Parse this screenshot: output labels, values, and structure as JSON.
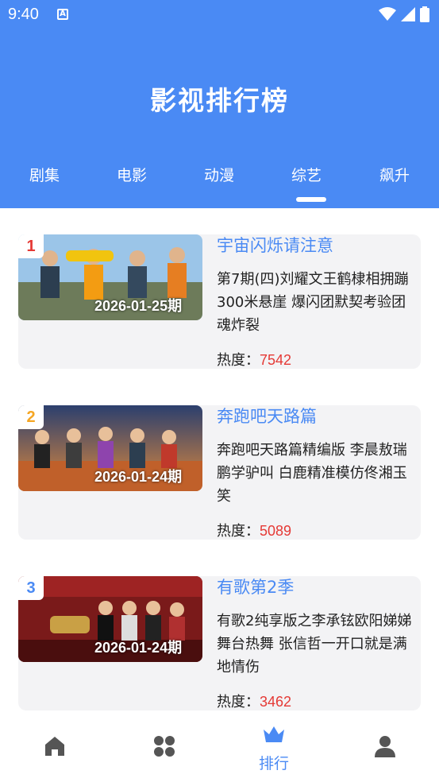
{
  "status": {
    "time": "9:40",
    "app_icon_letter": "A"
  },
  "app_title": "影视排行榜",
  "tabs": [
    {
      "label": "剧集"
    },
    {
      "label": "电影"
    },
    {
      "label": "动漫"
    },
    {
      "label": "综艺",
      "active": true
    },
    {
      "label": "飙升"
    }
  ],
  "items": [
    {
      "rank": "1",
      "rank_color": "#e53935",
      "date": "2026-01-25期",
      "title": "宇宙闪烁请注意",
      "desc": "第7期(四)刘耀文王鹤棣相拥蹦300米悬崖 爆闪团默契考验团魂炸裂",
      "heat_label": "热度：",
      "heat_value": "7542"
    },
    {
      "rank": "2",
      "rank_color": "#f5a623",
      "date": "2026-01-24期",
      "title": "奔跑吧天路篇",
      "desc": "奔跑吧天路篇精编版 李晨敖瑞鹏学驴叫  白鹿精准模仿佟湘玉笑",
      "heat_label": "热度：",
      "heat_value": "5089"
    },
    {
      "rank": "3",
      "rank_color": "#4a8af4",
      "date": "2026-01-24期",
      "title": "有歌第2季",
      "desc": "有歌2纯享版之李承铉欧阳娣娣舞台热舞 张信哲一开口就是满地情伤",
      "heat_label": "热度：",
      "heat_value": "3462"
    }
  ],
  "bottom_nav": [
    {
      "icon": "home-icon",
      "label": ""
    },
    {
      "icon": "category-icon",
      "label": ""
    },
    {
      "icon": "crown-icon",
      "label": "排行",
      "active": true
    },
    {
      "icon": "profile-icon",
      "label": ""
    }
  ],
  "colors": {
    "primary": "#4a8af4",
    "heat": "#e53935",
    "card_bg": "#f3f3f5",
    "nav_inactive": "#555555"
  }
}
